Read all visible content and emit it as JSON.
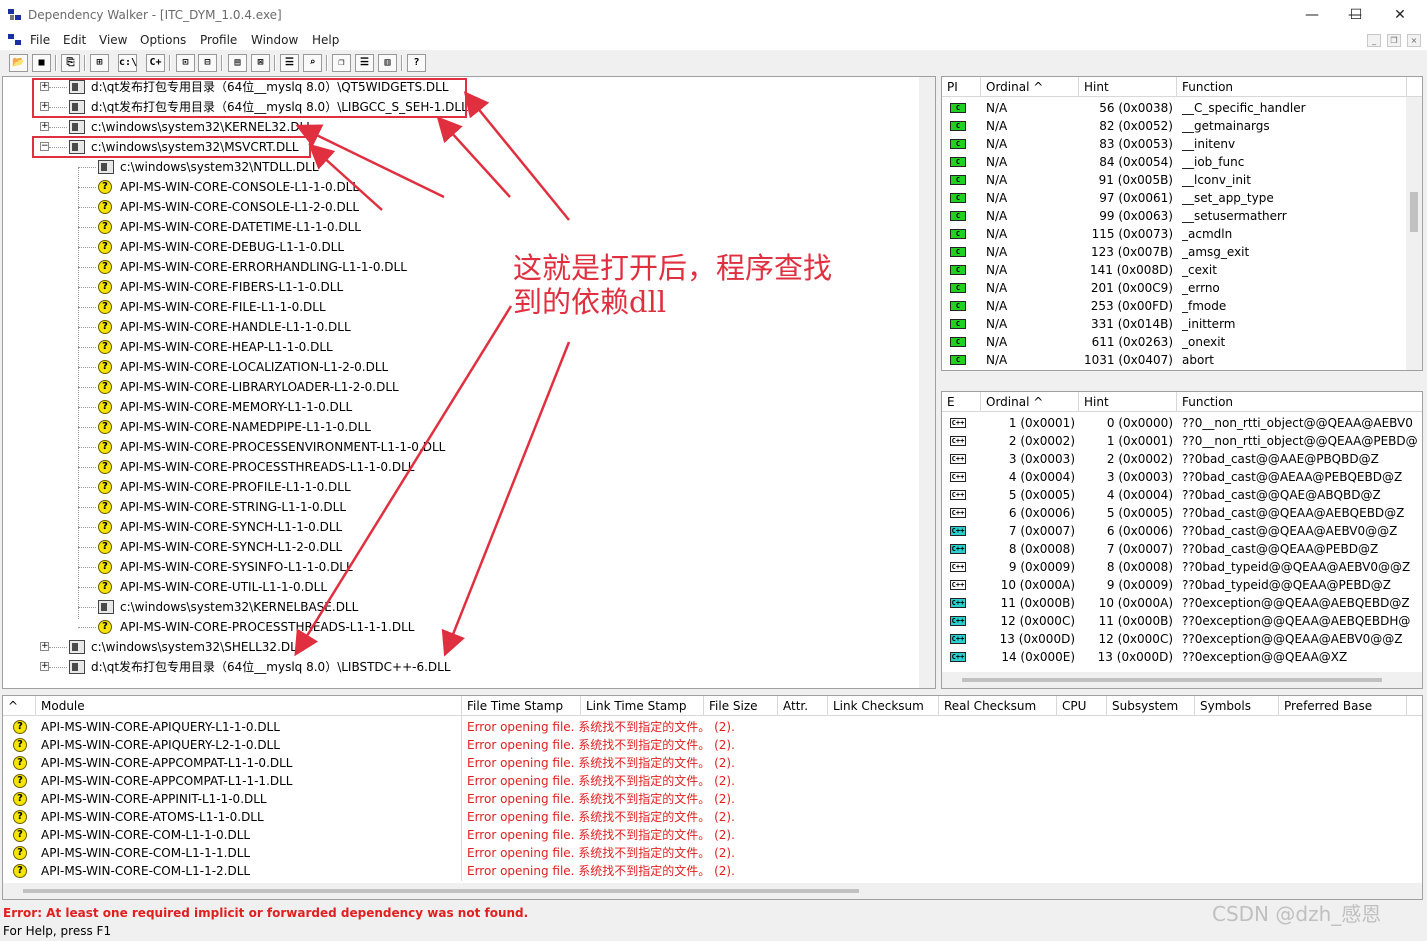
{
  "window": {
    "title": "Dependency Walker - [ITC_DYM_1.0.4.exe]",
    "minimize": "—",
    "maximize": "☐",
    "close": "✕"
  },
  "menu": [
    "File",
    "Edit",
    "View",
    "Options",
    "Profile",
    "Window",
    "Help"
  ],
  "toolbar": [
    "open",
    "save",
    "copy",
    "find",
    "view-full-paths",
    "c:\\",
    "C++",
    "expand-all",
    "properties",
    "system-info",
    "module-list",
    "autoexpand",
    "cascade",
    "tile-horizontal",
    "tile-vertical",
    "help"
  ],
  "tree": [
    {
      "label": "d:\\qt发布打包专用目录（64位__myslq 8.0）\\QT5WIDGETS.DLL",
      "indent": 0,
      "expander": "+",
      "icon": "module"
    },
    {
      "label": "d:\\qt发布打包专用目录（64位__myslq 8.0）\\LIBGCC_S_SEH-1.DLL",
      "indent": 0,
      "expander": "+",
      "icon": "module"
    },
    {
      "label": "c:\\windows\\system32\\KERNEL32.DLL",
      "indent": 0,
      "expander": "+",
      "icon": "module"
    },
    {
      "label": "c:\\windows\\system32\\MSVCRT.DLL",
      "indent": 0,
      "expander": "−",
      "icon": "module"
    },
    {
      "label": "c:\\windows\\system32\\NTDLL.DLL",
      "indent": 1,
      "expander": "",
      "icon": "module"
    },
    {
      "label": "API-MS-WIN-CORE-CONSOLE-L1-1-0.DLL",
      "indent": 1,
      "expander": "",
      "icon": "missing"
    },
    {
      "label": "API-MS-WIN-CORE-CONSOLE-L1-2-0.DLL",
      "indent": 1,
      "expander": "",
      "icon": "missing"
    },
    {
      "label": "API-MS-WIN-CORE-DATETIME-L1-1-0.DLL",
      "indent": 1,
      "expander": "",
      "icon": "missing"
    },
    {
      "label": "API-MS-WIN-CORE-DEBUG-L1-1-0.DLL",
      "indent": 1,
      "expander": "",
      "icon": "missing"
    },
    {
      "label": "API-MS-WIN-CORE-ERRORHANDLING-L1-1-0.DLL",
      "indent": 1,
      "expander": "",
      "icon": "missing"
    },
    {
      "label": "API-MS-WIN-CORE-FIBERS-L1-1-0.DLL",
      "indent": 1,
      "expander": "",
      "icon": "missing"
    },
    {
      "label": "API-MS-WIN-CORE-FILE-L1-1-0.DLL",
      "indent": 1,
      "expander": "",
      "icon": "missing"
    },
    {
      "label": "API-MS-WIN-CORE-HANDLE-L1-1-0.DLL",
      "indent": 1,
      "expander": "",
      "icon": "missing"
    },
    {
      "label": "API-MS-WIN-CORE-HEAP-L1-1-0.DLL",
      "indent": 1,
      "expander": "",
      "icon": "missing"
    },
    {
      "label": "API-MS-WIN-CORE-LOCALIZATION-L1-2-0.DLL",
      "indent": 1,
      "expander": "",
      "icon": "missing"
    },
    {
      "label": "API-MS-WIN-CORE-LIBRARYLOADER-L1-2-0.DLL",
      "indent": 1,
      "expander": "",
      "icon": "missing"
    },
    {
      "label": "API-MS-WIN-CORE-MEMORY-L1-1-0.DLL",
      "indent": 1,
      "expander": "",
      "icon": "missing"
    },
    {
      "label": "API-MS-WIN-CORE-NAMEDPIPE-L1-1-0.DLL",
      "indent": 1,
      "expander": "",
      "icon": "missing"
    },
    {
      "label": "API-MS-WIN-CORE-PROCESSENVIRONMENT-L1-1-0.DLL",
      "indent": 1,
      "expander": "",
      "icon": "missing"
    },
    {
      "label": "API-MS-WIN-CORE-PROCESSTHREADS-L1-1-0.DLL",
      "indent": 1,
      "expander": "",
      "icon": "missing"
    },
    {
      "label": "API-MS-WIN-CORE-PROFILE-L1-1-0.DLL",
      "indent": 1,
      "expander": "",
      "icon": "missing"
    },
    {
      "label": "API-MS-WIN-CORE-STRING-L1-1-0.DLL",
      "indent": 1,
      "expander": "",
      "icon": "missing"
    },
    {
      "label": "API-MS-WIN-CORE-SYNCH-L1-1-0.DLL",
      "indent": 1,
      "expander": "",
      "icon": "missing"
    },
    {
      "label": "API-MS-WIN-CORE-SYNCH-L1-2-0.DLL",
      "indent": 1,
      "expander": "",
      "icon": "missing"
    },
    {
      "label": "API-MS-WIN-CORE-SYSINFO-L1-1-0.DLL",
      "indent": 1,
      "expander": "",
      "icon": "missing"
    },
    {
      "label": "API-MS-WIN-CORE-UTIL-L1-1-0.DLL",
      "indent": 1,
      "expander": "",
      "icon": "missing"
    },
    {
      "label": "c:\\windows\\system32\\KERNELBASE.DLL",
      "indent": 1,
      "expander": "",
      "icon": "module"
    },
    {
      "label": "API-MS-WIN-CORE-PROCESSTHREADS-L1-1-1.DLL",
      "indent": 1,
      "expander": "",
      "icon": "missing"
    },
    {
      "label": "c:\\windows\\system32\\SHELL32.DLL",
      "indent": 0,
      "expander": "+",
      "icon": "module"
    },
    {
      "label": "d:\\qt发布打包专用目录（64位__myslq 8.0）\\LIBSTDC++-6.DLL",
      "indent": 0,
      "expander": "+",
      "icon": "module"
    }
  ],
  "annotation": {
    "line1": "这就是打开后，程序查找",
    "line2": "到的依赖dll",
    "color": "#e03040"
  },
  "imports": {
    "headers": [
      "PI",
      "Ordinal ^",
      "Hint",
      "Function"
    ],
    "rows": [
      {
        "pi": "C",
        "ordinal": "N/A",
        "hint": "56 (0x0038)",
        "function": "__C_specific_handler"
      },
      {
        "pi": "C",
        "ordinal": "N/A",
        "hint": "82 (0x0052)",
        "function": "__getmainargs"
      },
      {
        "pi": "C",
        "ordinal": "N/A",
        "hint": "83 (0x0053)",
        "function": "__initenv"
      },
      {
        "pi": "C",
        "ordinal": "N/A",
        "hint": "84 (0x0054)",
        "function": "__iob_func"
      },
      {
        "pi": "C",
        "ordinal": "N/A",
        "hint": "91 (0x005B)",
        "function": "__lconv_init"
      },
      {
        "pi": "C",
        "ordinal": "N/A",
        "hint": "97 (0x0061)",
        "function": "__set_app_type"
      },
      {
        "pi": "C",
        "ordinal": "N/A",
        "hint": "99 (0x0063)",
        "function": "__setusermatherr"
      },
      {
        "pi": "C",
        "ordinal": "N/A",
        "hint": "115 (0x0073)",
        "function": "_acmdln"
      },
      {
        "pi": "C",
        "ordinal": "N/A",
        "hint": "123 (0x007B)",
        "function": "_amsg_exit"
      },
      {
        "pi": "C",
        "ordinal": "N/A",
        "hint": "141 (0x008D)",
        "function": "_cexit"
      },
      {
        "pi": "C",
        "ordinal": "N/A",
        "hint": "201 (0x00C9)",
        "function": "_errno"
      },
      {
        "pi": "C",
        "ordinal": "N/A",
        "hint": "253 (0x00FD)",
        "function": "_fmode"
      },
      {
        "pi": "C",
        "ordinal": "N/A",
        "hint": "331 (0x014B)",
        "function": "_initterm"
      },
      {
        "pi": "C",
        "ordinal": "N/A",
        "hint": "611 (0x0263)",
        "function": "_onexit"
      },
      {
        "pi": "C",
        "ordinal": "N/A",
        "hint": "1031 (0x0407)",
        "function": "abort"
      }
    ]
  },
  "exports": {
    "headers": [
      "E",
      "Ordinal ^",
      "Hint",
      "Function"
    ],
    "rows": [
      {
        "e": "C++",
        "kind": "w",
        "ordinal": "1 (0x0001)",
        "hint": "0 (0x0000)",
        "function": "??0__non_rtti_object@@QEAA@AEBV0"
      },
      {
        "e": "C++",
        "kind": "w",
        "ordinal": "2 (0x0002)",
        "hint": "1 (0x0001)",
        "function": "??0__non_rtti_object@@QEAA@PEBD@"
      },
      {
        "e": "C++",
        "kind": "w",
        "ordinal": "3 (0x0003)",
        "hint": "2 (0x0002)",
        "function": "??0bad_cast@@AAE@PBQBD@Z"
      },
      {
        "e": "C++",
        "kind": "w",
        "ordinal": "4 (0x0004)",
        "hint": "3 (0x0003)",
        "function": "??0bad_cast@@AEAA@PEBQEBD@Z"
      },
      {
        "e": "C++",
        "kind": "w",
        "ordinal": "5 (0x0005)",
        "hint": "4 (0x0004)",
        "function": "??0bad_cast@@QAE@ABQBD@Z"
      },
      {
        "e": "C++",
        "kind": "w",
        "ordinal": "6 (0x0006)",
        "hint": "5 (0x0005)",
        "function": "??0bad_cast@@QEAA@AEBQEBD@Z"
      },
      {
        "e": "C++",
        "kind": "c",
        "ordinal": "7 (0x0007)",
        "hint": "6 (0x0006)",
        "function": "??0bad_cast@@QEAA@AEBV0@@Z"
      },
      {
        "e": "C++",
        "kind": "c",
        "ordinal": "8 (0x0008)",
        "hint": "7 (0x0007)",
        "function": "??0bad_cast@@QEAA@PEBD@Z"
      },
      {
        "e": "C++",
        "kind": "w",
        "ordinal": "9 (0x0009)",
        "hint": "8 (0x0008)",
        "function": "??0bad_typeid@@QEAA@AEBV0@@Z"
      },
      {
        "e": "C++",
        "kind": "w",
        "ordinal": "10 (0x000A)",
        "hint": "9 (0x0009)",
        "function": "??0bad_typeid@@QEAA@PEBD@Z"
      },
      {
        "e": "C++",
        "kind": "c",
        "ordinal": "11 (0x000B)",
        "hint": "10 (0x000A)",
        "function": "??0exception@@QEAA@AEBQEBD@Z"
      },
      {
        "e": "C++",
        "kind": "c",
        "ordinal": "12 (0x000C)",
        "hint": "11 (0x000B)",
        "function": "??0exception@@QEAA@AEBQEBDH@"
      },
      {
        "e": "C++",
        "kind": "c",
        "ordinal": "13 (0x000D)",
        "hint": "12 (0x000C)",
        "function": "??0exception@@QEAA@AEBV0@@Z"
      },
      {
        "e": "C++",
        "kind": "c",
        "ordinal": "14 (0x000E)",
        "hint": "13 (0x000D)",
        "function": "??0exception@@QEAA@XZ"
      }
    ]
  },
  "modules": {
    "headers": [
      "^",
      "Module",
      "File Time Stamp",
      "Link Time Stamp",
      "File Size",
      "Attr.",
      "Link Checksum",
      "Real Checksum",
      "CPU",
      "Subsystem",
      "Symbols",
      "Preferred Base"
    ],
    "error_text": "Error opening file. 系统找不到指定的文件。 (2).",
    "rows": [
      "API-MS-WIN-CORE-APIQUERY-L1-1-0.DLL",
      "API-MS-WIN-CORE-APIQUERY-L2-1-0.DLL",
      "API-MS-WIN-CORE-APPCOMPAT-L1-1-0.DLL",
      "API-MS-WIN-CORE-APPCOMPAT-L1-1-1.DLL",
      "API-MS-WIN-CORE-APPINIT-L1-1-0.DLL",
      "API-MS-WIN-CORE-ATOMS-L1-1-0.DLL",
      "API-MS-WIN-CORE-COM-L1-1-0.DLL",
      "API-MS-WIN-CORE-COM-L1-1-1.DLL",
      "API-MS-WIN-CORE-COM-L1-1-2.DLL"
    ]
  },
  "status": {
    "error": "Error: At least one required implicit or forwarded dependency was not found.",
    "help": "For Help, press F1",
    "watermark": "CSDN @dzh_感恩"
  }
}
